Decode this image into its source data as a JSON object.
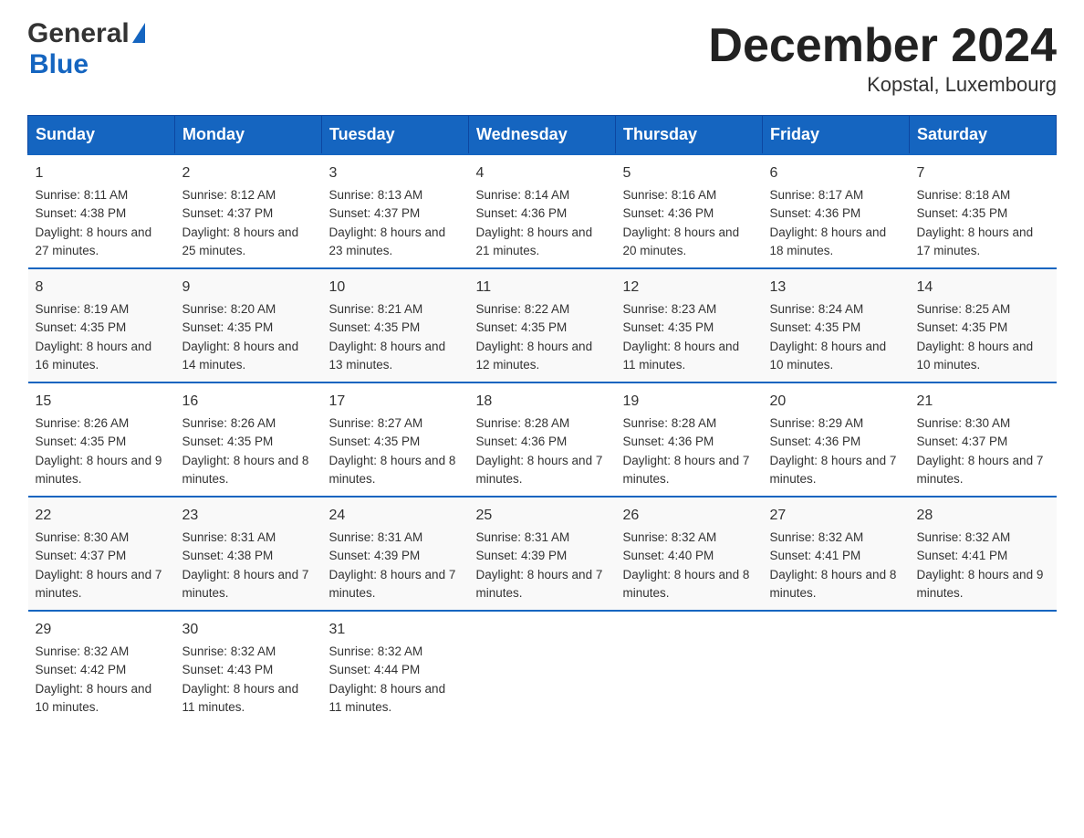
{
  "header": {
    "logo_general": "General",
    "logo_blue": "Blue",
    "month_title": "December 2024",
    "location": "Kopstal, Luxembourg"
  },
  "days_of_week": [
    "Sunday",
    "Monday",
    "Tuesday",
    "Wednesday",
    "Thursday",
    "Friday",
    "Saturday"
  ],
  "weeks": [
    [
      {
        "day": "1",
        "sunrise": "8:11 AM",
        "sunset": "4:38 PM",
        "daylight": "8 hours and 27 minutes."
      },
      {
        "day": "2",
        "sunrise": "8:12 AM",
        "sunset": "4:37 PM",
        "daylight": "8 hours and 25 minutes."
      },
      {
        "day": "3",
        "sunrise": "8:13 AM",
        "sunset": "4:37 PM",
        "daylight": "8 hours and 23 minutes."
      },
      {
        "day": "4",
        "sunrise": "8:14 AM",
        "sunset": "4:36 PM",
        "daylight": "8 hours and 21 minutes."
      },
      {
        "day": "5",
        "sunrise": "8:16 AM",
        "sunset": "4:36 PM",
        "daylight": "8 hours and 20 minutes."
      },
      {
        "day": "6",
        "sunrise": "8:17 AM",
        "sunset": "4:36 PM",
        "daylight": "8 hours and 18 minutes."
      },
      {
        "day": "7",
        "sunrise": "8:18 AM",
        "sunset": "4:35 PM",
        "daylight": "8 hours and 17 minutes."
      }
    ],
    [
      {
        "day": "8",
        "sunrise": "8:19 AM",
        "sunset": "4:35 PM",
        "daylight": "8 hours and 16 minutes."
      },
      {
        "day": "9",
        "sunrise": "8:20 AM",
        "sunset": "4:35 PM",
        "daylight": "8 hours and 14 minutes."
      },
      {
        "day": "10",
        "sunrise": "8:21 AM",
        "sunset": "4:35 PM",
        "daylight": "8 hours and 13 minutes."
      },
      {
        "day": "11",
        "sunrise": "8:22 AM",
        "sunset": "4:35 PM",
        "daylight": "8 hours and 12 minutes."
      },
      {
        "day": "12",
        "sunrise": "8:23 AM",
        "sunset": "4:35 PM",
        "daylight": "8 hours and 11 minutes."
      },
      {
        "day": "13",
        "sunrise": "8:24 AM",
        "sunset": "4:35 PM",
        "daylight": "8 hours and 10 minutes."
      },
      {
        "day": "14",
        "sunrise": "8:25 AM",
        "sunset": "4:35 PM",
        "daylight": "8 hours and 10 minutes."
      }
    ],
    [
      {
        "day": "15",
        "sunrise": "8:26 AM",
        "sunset": "4:35 PM",
        "daylight": "8 hours and 9 minutes."
      },
      {
        "day": "16",
        "sunrise": "8:26 AM",
        "sunset": "4:35 PM",
        "daylight": "8 hours and 8 minutes."
      },
      {
        "day": "17",
        "sunrise": "8:27 AM",
        "sunset": "4:35 PM",
        "daylight": "8 hours and 8 minutes."
      },
      {
        "day": "18",
        "sunrise": "8:28 AM",
        "sunset": "4:36 PM",
        "daylight": "8 hours and 7 minutes."
      },
      {
        "day": "19",
        "sunrise": "8:28 AM",
        "sunset": "4:36 PM",
        "daylight": "8 hours and 7 minutes."
      },
      {
        "day": "20",
        "sunrise": "8:29 AM",
        "sunset": "4:36 PM",
        "daylight": "8 hours and 7 minutes."
      },
      {
        "day": "21",
        "sunrise": "8:30 AM",
        "sunset": "4:37 PM",
        "daylight": "8 hours and 7 minutes."
      }
    ],
    [
      {
        "day": "22",
        "sunrise": "8:30 AM",
        "sunset": "4:37 PM",
        "daylight": "8 hours and 7 minutes."
      },
      {
        "day": "23",
        "sunrise": "8:31 AM",
        "sunset": "4:38 PM",
        "daylight": "8 hours and 7 minutes."
      },
      {
        "day": "24",
        "sunrise": "8:31 AM",
        "sunset": "4:39 PM",
        "daylight": "8 hours and 7 minutes."
      },
      {
        "day": "25",
        "sunrise": "8:31 AM",
        "sunset": "4:39 PM",
        "daylight": "8 hours and 7 minutes."
      },
      {
        "day": "26",
        "sunrise": "8:32 AM",
        "sunset": "4:40 PM",
        "daylight": "8 hours and 8 minutes."
      },
      {
        "day": "27",
        "sunrise": "8:32 AM",
        "sunset": "4:41 PM",
        "daylight": "8 hours and 8 minutes."
      },
      {
        "day": "28",
        "sunrise": "8:32 AM",
        "sunset": "4:41 PM",
        "daylight": "8 hours and 9 minutes."
      }
    ],
    [
      {
        "day": "29",
        "sunrise": "8:32 AM",
        "sunset": "4:42 PM",
        "daylight": "8 hours and 10 minutes."
      },
      {
        "day": "30",
        "sunrise": "8:32 AM",
        "sunset": "4:43 PM",
        "daylight": "8 hours and 11 minutes."
      },
      {
        "day": "31",
        "sunrise": "8:32 AM",
        "sunset": "4:44 PM",
        "daylight": "8 hours and 11 minutes."
      },
      null,
      null,
      null,
      null
    ]
  ],
  "labels": {
    "sunrise_prefix": "Sunrise: ",
    "sunset_prefix": "Sunset: ",
    "daylight_prefix": "Daylight: "
  }
}
